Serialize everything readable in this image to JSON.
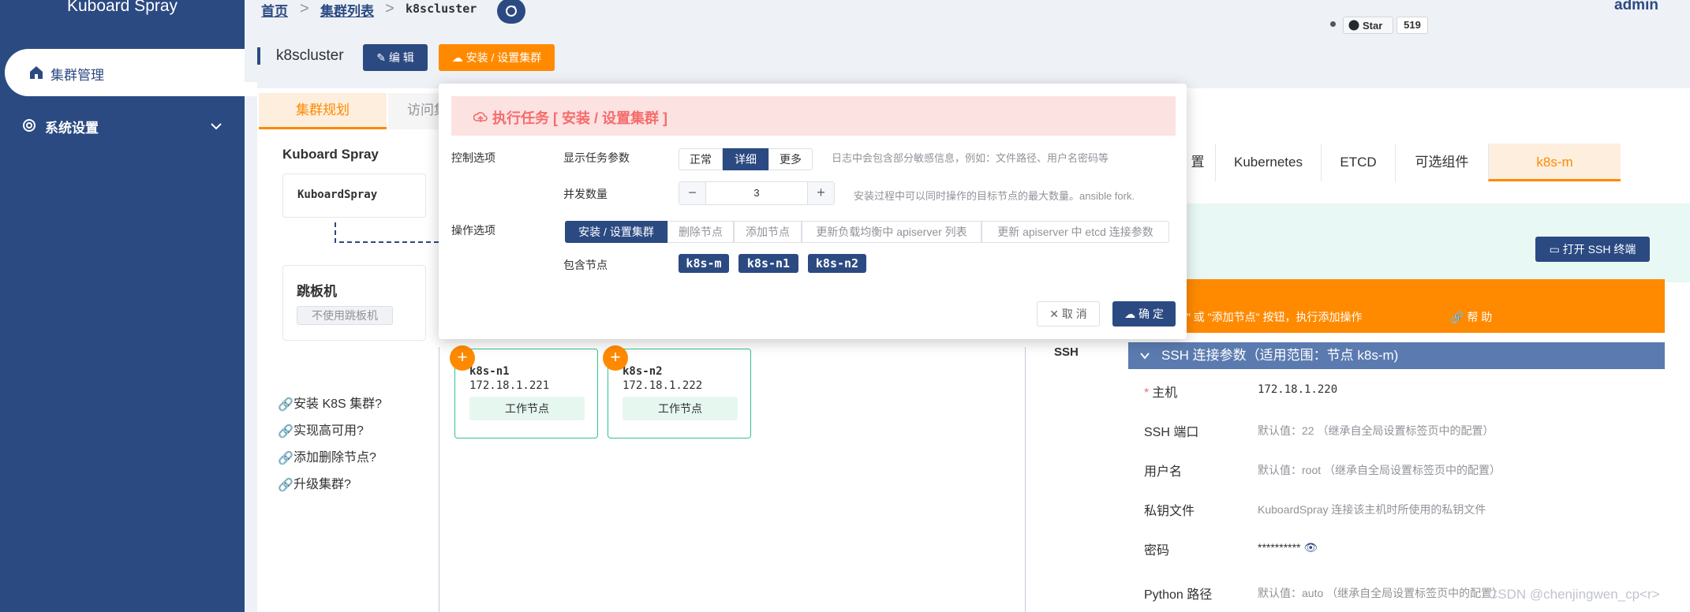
{
  "app": {
    "brand": "Kuboard Spray"
  },
  "sidebar": {
    "items": [
      {
        "label": "集群管理",
        "icon": "home-icon"
      },
      {
        "label": "系统设置",
        "icon": "gear-icon"
      }
    ]
  },
  "header": {
    "breadcrumb": [
      "首页",
      "集群列表",
      "k8scluster"
    ],
    "user": "admin",
    "github": {
      "star_label": "Star",
      "star_count": "519"
    }
  },
  "page": {
    "title": "k8scluster",
    "edit_label": "编 辑",
    "install_label": "安装 / 设置集群"
  },
  "tabs": {
    "plan": "集群规划",
    "access": "访问集"
  },
  "left": {
    "title": "Kuboard Spray",
    "node": "KuboardSpray",
    "jump_title": "跳板机",
    "jump_tag": "不使用跳板机",
    "links": [
      "安装 K8S 集群?",
      "实现高可用?",
      "添加删除节点?",
      "升级集群?"
    ]
  },
  "workers": [
    {
      "name": "k8s-n1",
      "ip": "172.18.1.221",
      "role": "工作节点"
    },
    {
      "name": "k8s-n2",
      "ip": "172.18.1.222",
      "role": "工作节点"
    }
  ],
  "right": {
    "tabs": [
      "置",
      "Kubernetes",
      "ETCD",
      "可选组件",
      "k8s-m"
    ],
    "ssh_btn": "打开 SSH 终端",
    "banner_text": "装/设置集群\" 或 \"添加节点\" 按钮，执行添加操作",
    "banner_help": "帮 助",
    "ssh_label": "SSH",
    "ssh_header": "SSH 连接参数（适用范围：节点 k8s-m)",
    "fields": [
      {
        "label": "主机",
        "value": "172.18.1.220"
      },
      {
        "label": "SSH 端口",
        "value": "默认值：22 （继承自全局设置标签页中的配置）"
      },
      {
        "label": "用户名",
        "value": "默认值：root （继承自全局设置标签页中的配置）"
      },
      {
        "label": "私钥文件",
        "value": "KuboardSpray 连接该主机时所使用的私钥文件"
      },
      {
        "label": "密码",
        "value": "**********"
      },
      {
        "label": "Python 路径",
        "value": "默认值：auto （继承自全局设置标签页中的配置）"
      }
    ]
  },
  "modal": {
    "title": "执行任务 [ 安装 / 设置集群 ]",
    "control_label": "控制选项",
    "show_params_label": "显示任务参数",
    "verbosity": [
      "正常",
      "详细",
      "更多"
    ],
    "verbosity_hint": "日志中会包含部分敏感信息，例如：文件路径、用户名密码等",
    "fork_label": "并发数量",
    "fork_value": "3",
    "fork_hint": "安装过程中可以同时操作的目标节点的最大数量。ansible fork.",
    "op_label": "操作选项",
    "ops": [
      "安装 / 设置集群",
      "删除节点",
      "添加节点",
      "更新负载均衡中 apiserver 列表",
      "更新 apiserver 中 etcd 连接参数"
    ],
    "nodes_label": "包含节点",
    "nodes": [
      "k8s-m",
      "k8s-n1",
      "k8s-n2"
    ],
    "cancel": "取 消",
    "ok": "确 定"
  },
  "watermark": "CSDN @chenjingwen_cp<r>",
  "colors": {
    "primary": "#2b4a82",
    "accent": "#ff8a00",
    "danger": "#f56c6c",
    "success": "#34c38f"
  }
}
